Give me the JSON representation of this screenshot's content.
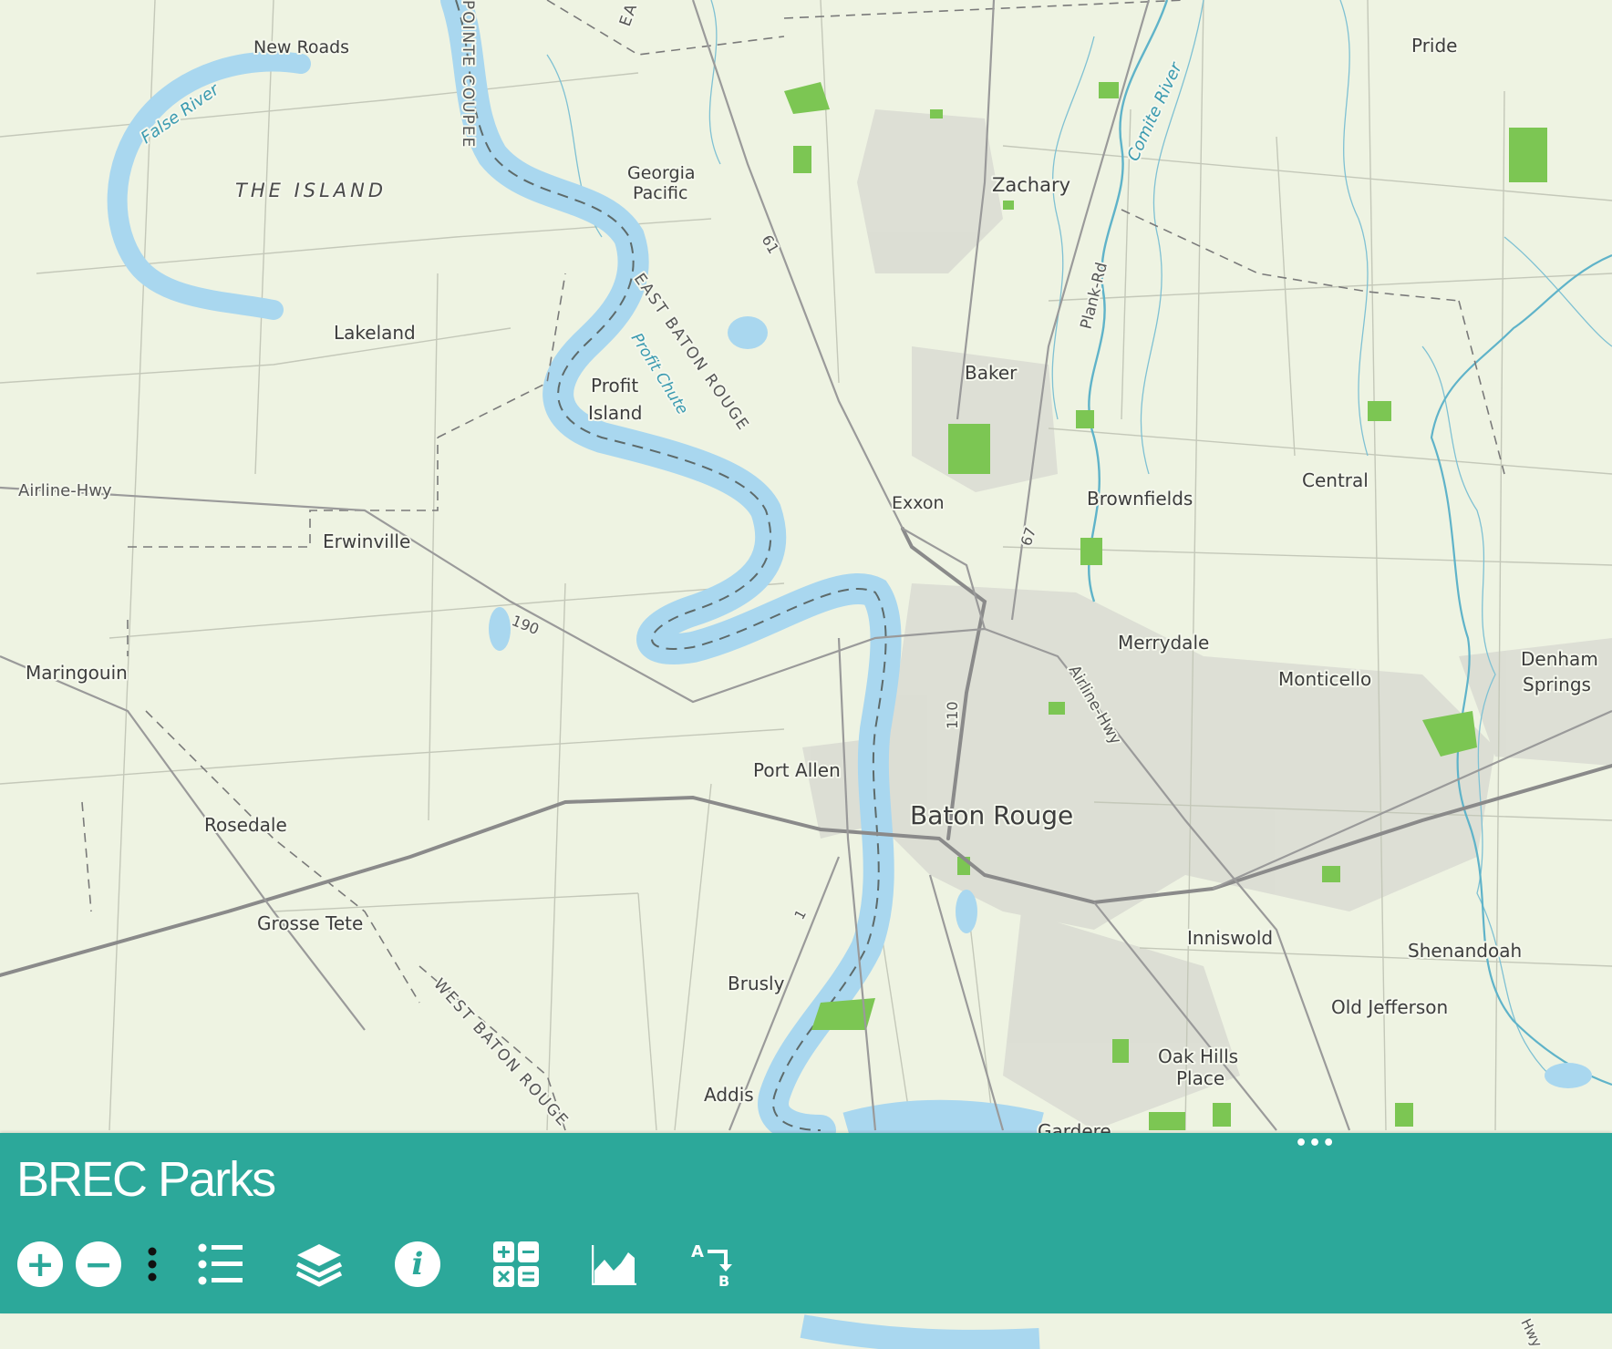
{
  "map": {
    "places": [
      {
        "name": "New Roads"
      },
      {
        "name": "Pride"
      },
      {
        "name": "Georgia"
      },
      {
        "name": "Pacific"
      },
      {
        "name": "Zachary"
      },
      {
        "name": "Lakeland"
      },
      {
        "name": "Baker"
      },
      {
        "name": "Profit"
      },
      {
        "name": "Island"
      },
      {
        "name": "Exxon"
      },
      {
        "name": "Brownfields"
      },
      {
        "name": "Central"
      },
      {
        "name": "Erwinville"
      },
      {
        "name": "Merrydale"
      },
      {
        "name": "Denham"
      },
      {
        "name": "Springs"
      },
      {
        "name": "Maringouin"
      },
      {
        "name": "Monticello"
      },
      {
        "name": "Port Allen"
      },
      {
        "name": "Baton Rouge"
      },
      {
        "name": "Rosedale"
      },
      {
        "name": "Grosse Tete"
      },
      {
        "name": "Inniswold"
      },
      {
        "name": "Shenandoah"
      },
      {
        "name": "Brusly"
      },
      {
        "name": "Old Jefferson"
      },
      {
        "name": "Oak Hills"
      },
      {
        "name": "Place"
      },
      {
        "name": "Addis"
      },
      {
        "name": "Gardere"
      }
    ],
    "regions": [
      "THE ISLAND"
    ],
    "water_labels": [
      "False River",
      "Comite River",
      "Profit Chute"
    ],
    "parish_labels": [
      "EAST BATON ROUGE",
      "WEST BATON ROUGE",
      "POINTE COUPEE",
      "EA"
    ],
    "road_labels": [
      "Airline-Hwy",
      "Airline-Hwy",
      "Plank-Rd",
      "61",
      "190",
      "67",
      "110",
      "1",
      "Hwy"
    ],
    "colors": {
      "background": "#eef3e2",
      "water": "#a9d7ef",
      "park": "#7cc653",
      "urban": "#d7d7cf",
      "road_major": "#7a7a7a",
      "road_minor": "#b9bdb0",
      "boundary": "#777777"
    }
  },
  "panel": {
    "title": "BREC Parks",
    "more_icon": "more-horizontal-icon",
    "background": "#2ca89a",
    "toolbar": [
      {
        "icon": "zoom-in-icon",
        "symbol": "+"
      },
      {
        "icon": "zoom-out-icon",
        "symbol": "−"
      },
      {
        "icon": "vertical-ellipsis-icon",
        "symbol": "⋮"
      },
      {
        "icon": "legend-list-icon"
      },
      {
        "icon": "layers-icon"
      },
      {
        "icon": "info-icon",
        "symbol": "i"
      },
      {
        "icon": "calculator-icon"
      },
      {
        "icon": "elevation-profile-icon"
      },
      {
        "icon": "directions-icon",
        "symbol_a": "A",
        "symbol_b": "B"
      }
    ]
  }
}
